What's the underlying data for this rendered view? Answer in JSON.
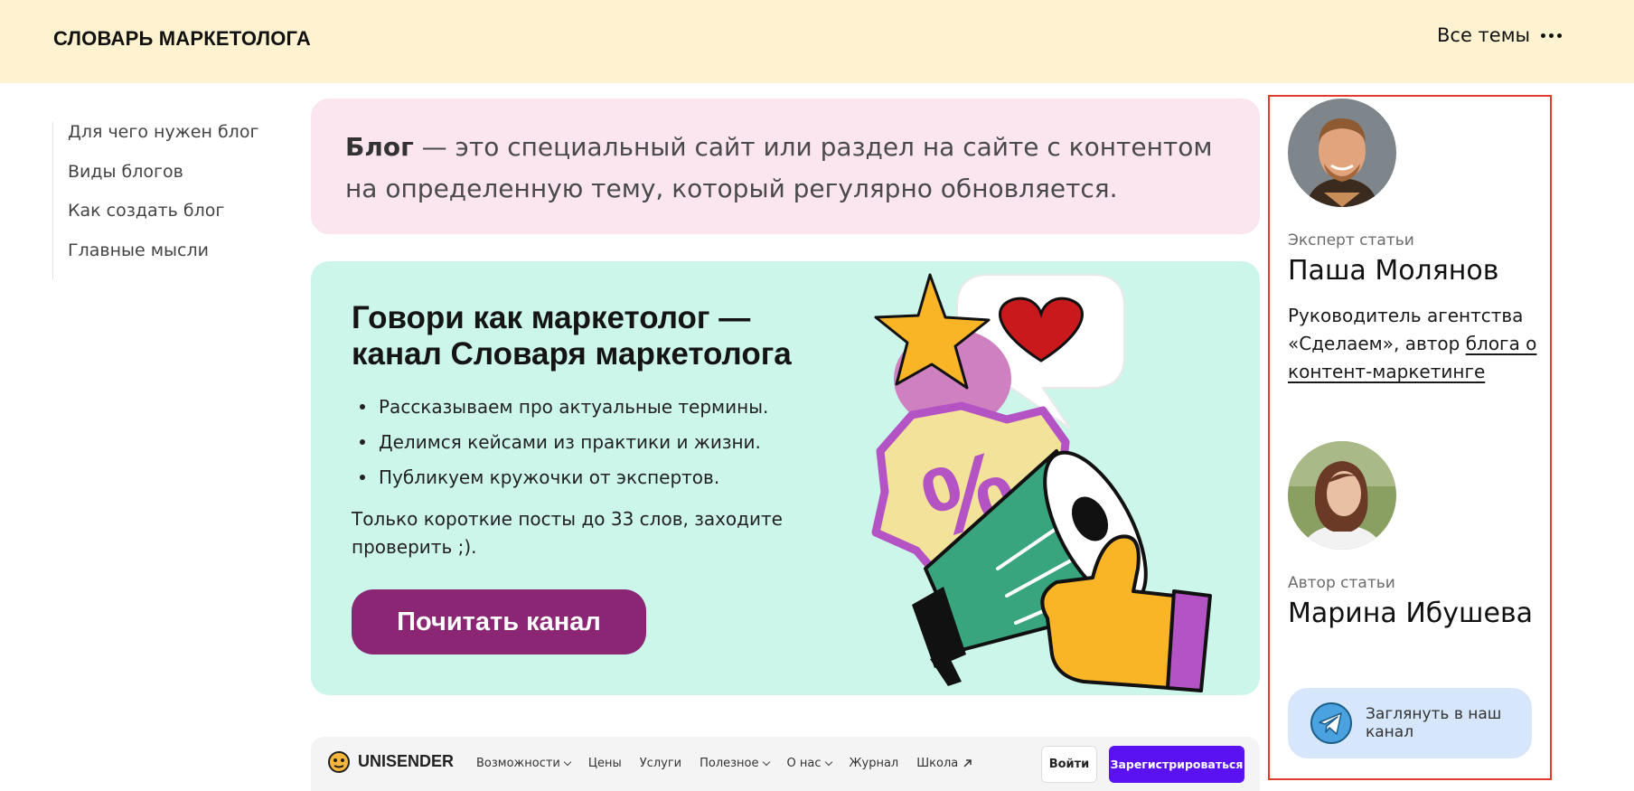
{
  "header": {
    "logo": "СЛОВАРЬ МАРКЕТОЛОГА",
    "topics_label": "Все темы",
    "background": "#fef2d0"
  },
  "toc": {
    "items": [
      {
        "label": "Для чего нужен блог"
      },
      {
        "label": "Виды блогов"
      },
      {
        "label": "Как создать блог"
      },
      {
        "label": "Главные мысли"
      }
    ]
  },
  "definition": {
    "term": "Блог",
    "text": " — это специальный сайт или раздел на сайте с контентом на определенную тему, который регулярно обновляется.",
    "background": "#fbe6f0"
  },
  "promo": {
    "title": "Говори как маркетолог — канал Словаря маркетолога",
    "bullets": [
      "Рассказываем про актуальные термины.",
      "Делимся кейсами из практики и жизни.",
      "Публикуем кружочки от экспертов."
    ],
    "note": "Только короткие посты до 33 слов, заходите проверить ;).",
    "button_label": "Почитать канал",
    "background": "#cdf6ea",
    "button_color": "#8b2674"
  },
  "embed": {
    "logo_text": "UNISENDER",
    "nav": [
      {
        "label": "Возможности",
        "dropdown": true
      },
      {
        "label": "Цены",
        "dropdown": false
      },
      {
        "label": "Услуги",
        "dropdown": false
      },
      {
        "label": "Полезное",
        "dropdown": true
      },
      {
        "label": "О нас",
        "dropdown": true
      },
      {
        "label": "Журнал",
        "dropdown": false
      },
      {
        "label": "Школа",
        "dropdown": false,
        "external": true
      }
    ],
    "login_label": "Войти",
    "register_label": "Зарегистрироваться",
    "register_color": "#5a12f2"
  },
  "authors": {
    "expert": {
      "role": "Эксперт статьи",
      "name": "Паша Молянов",
      "desc_prefix": "Руководитель агентства «Сделаем», автор ",
      "desc_link": "блога о контент-маркетинге"
    },
    "author": {
      "role": "Автор статьи",
      "name": "Марина Ибушева"
    },
    "telegram_label": "Заглянуть в наш канал",
    "highlight_color": "#e53a2e"
  }
}
